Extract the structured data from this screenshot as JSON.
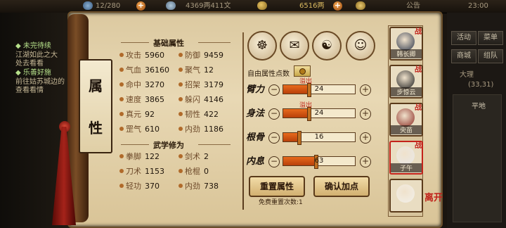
{
  "topbar": {
    "stamina": "12/280",
    "money": "4369两411文",
    "gold": "6516两",
    "announcement": "公告",
    "clock": "23:00"
  },
  "quests": [
    {
      "title": "◆ 未完待续",
      "desc": [
        "江湖如此之大",
        "处去看看"
      ]
    },
    {
      "title": "◆ 乐善好施",
      "desc": [
        "前往姑苏城边的",
        "查看看情"
      ]
    }
  ],
  "right_menu": {
    "buttons": [
      "活动",
      "菜单",
      "商城",
      "组队"
    ],
    "location": "大理",
    "coords": "(33,31)",
    "region": "平地"
  },
  "nameplate": {
    "chars": [
      "属",
      "性"
    ]
  },
  "basic": {
    "title": "基础属性",
    "left": [
      {
        "label": "攻击",
        "value": "5960"
      },
      {
        "label": "气血",
        "value": "36160"
      },
      {
        "label": "命中",
        "value": "3270"
      },
      {
        "label": "速度",
        "value": "3865"
      },
      {
        "label": "真元",
        "value": "92"
      },
      {
        "label": "罡气",
        "value": "610"
      }
    ],
    "right": [
      {
        "label": "防御",
        "value": "9459"
      },
      {
        "label": "聚气",
        "value": "12"
      },
      {
        "label": "招架",
        "value": "3179"
      },
      {
        "label": "躲闪",
        "value": "4146"
      },
      {
        "label": "韧性",
        "value": "422"
      },
      {
        "label": "内劲",
        "value": "1186"
      }
    ]
  },
  "martial": {
    "title": "武学修为",
    "left": [
      {
        "label": "拳脚",
        "value": "122"
      },
      {
        "label": "刀术",
        "value": "1153"
      },
      {
        "label": "轻功",
        "value": "370"
      }
    ],
    "right": [
      {
        "label": "剑术",
        "value": "2"
      },
      {
        "label": "枪棍",
        "value": "0"
      },
      {
        "label": "内劲",
        "value": "738"
      }
    ]
  },
  "points": {
    "free_label": "自由属性点数",
    "overflow_label": "溢出",
    "stats": [
      {
        "label": "臂力",
        "value": "24",
        "fill": 0.35,
        "overflow": true
      },
      {
        "label": "身法",
        "value": "24",
        "fill": 0.35,
        "overflow": true
      },
      {
        "label": "根骨",
        "value": "16",
        "fill": 0.22,
        "overflow": false
      },
      {
        "label": "内息",
        "value": "63",
        "fill": 0.45,
        "overflow": false
      }
    ]
  },
  "actions": {
    "reset": "重置属性",
    "confirm": "确认加点",
    "free_reset_note": "免费重置次数:1"
  },
  "characters": [
    {
      "name": "韩长卿",
      "selected": false
    },
    {
      "name": "步惊云",
      "selected": false
    },
    {
      "name": "央苗",
      "selected": false
    },
    {
      "name": "子午",
      "selected": true
    },
    {
      "name": "",
      "selected": false
    }
  ],
  "char_tag": "战",
  "leave_label": "离开",
  "colors": {
    "accent_red": "#c0221a",
    "bar_fill": "#e86a1c",
    "quest_green": "#b6e08a"
  }
}
